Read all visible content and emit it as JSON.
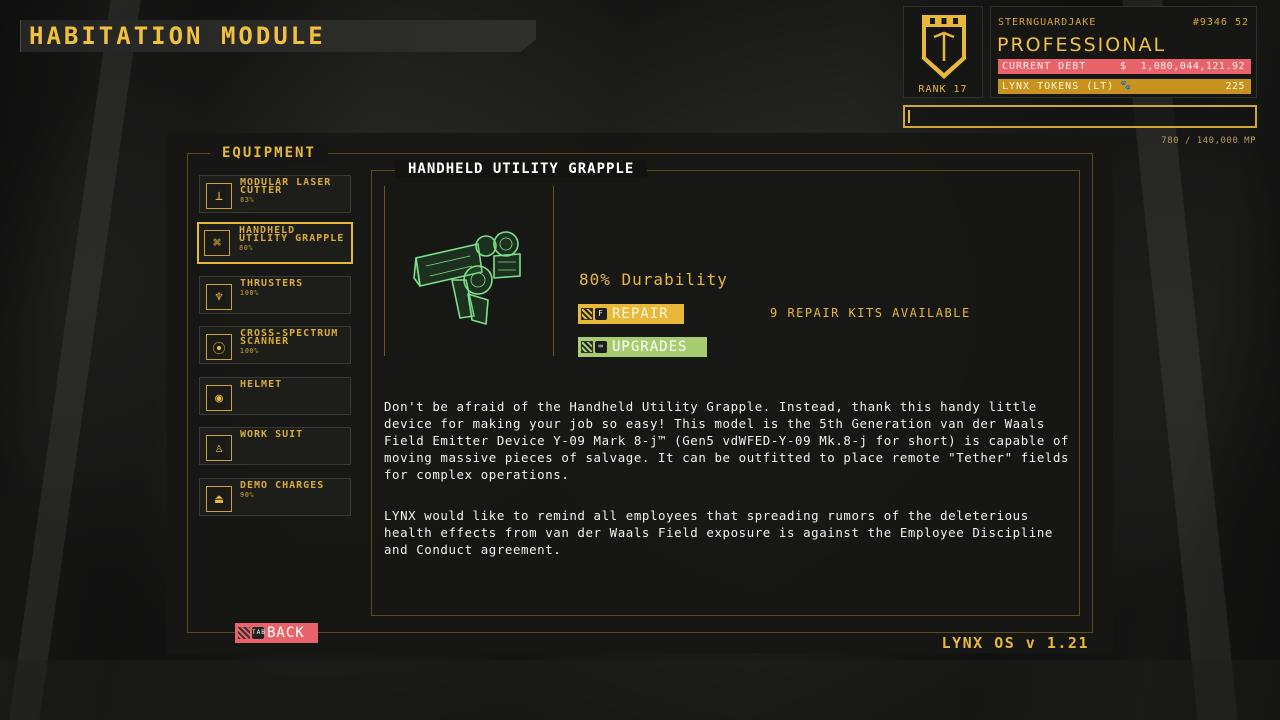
{
  "title": "HABITATION MODULE",
  "profile": {
    "rank_label": "RANK 17",
    "username": "STERNGUARDJAKE",
    "user_id": "#9346 52",
    "title": "PROFESSIONAL",
    "debt_label": "CURRENT DEBT",
    "debt_symbol": "$",
    "debt_value": "1,080,044,121.92",
    "tokens_label": "LYNX TOKENS (LT)",
    "tokens_symbol": "🐾",
    "tokens_value": "225",
    "mp_text": "780 / 140,000 MP",
    "mp_fraction": 0.0056
  },
  "equipment": {
    "heading": "EQUIPMENT",
    "items": [
      {
        "name": "MODULAR LASER CUTTER",
        "pct": "83%",
        "icon": "laser-cutter-icon",
        "glyph": "⊥"
      },
      {
        "name": "HANDHELD UTILITY GRAPPLE",
        "pct": "80%",
        "icon": "grapple-icon",
        "glyph": "⌘"
      },
      {
        "name": "THRUSTERS",
        "pct": "100%",
        "icon": "thrusters-icon",
        "glyph": "♆"
      },
      {
        "name": "CROSS-SPECTRUM SCANNER",
        "pct": "100%",
        "icon": "scanner-icon",
        "glyph": "⦿"
      },
      {
        "name": "HELMET",
        "pct": "",
        "icon": "helmet-icon",
        "glyph": "◉"
      },
      {
        "name": "WORK SUIT",
        "pct": "",
        "icon": "work-suit-icon",
        "glyph": "♙"
      },
      {
        "name": "DEMO CHARGES",
        "pct": "90%",
        "icon": "demo-charges-icon",
        "glyph": "⏏"
      }
    ]
  },
  "detail": {
    "heading": "HANDHELD UTILITY GRAPPLE",
    "durability": "80% Durability",
    "repair_label": "REPAIR",
    "repair_key": "F",
    "upgrades_label": "UPGRADES",
    "upgrades_key": "⌨",
    "repair_kits": "9 REPAIR KITS AVAILABLE",
    "description_1": "Don't be afraid of the Handheld Utility Grapple. Instead, thank this handy little device for making your job so easy! This model is the 5th Generation van der Waals Field Emitter Device Y-09 Mark 8-j™ (Gen5 vdWFED-Y-09 Mk.8-j for short) is capable of moving massive pieces of salvage. It can be outfitted to place remote \"Tether\" fields for complex operations.",
    "description_2": "LYNX would like to remind all employees that spreading rumors of the deleterious health effects from van der Waals Field exposure is against the Employee Discipline and Conduct agreement."
  },
  "footer": {
    "back_label": "BACK",
    "back_key": "TAB",
    "os_version": "LYNX OS v 1.21"
  },
  "colors": {
    "accent": "#e8b838",
    "debt": "#e8636a",
    "tokens": "#c7931e",
    "upgrades": "#a8cd6e",
    "hologram": "#7ee08a"
  }
}
